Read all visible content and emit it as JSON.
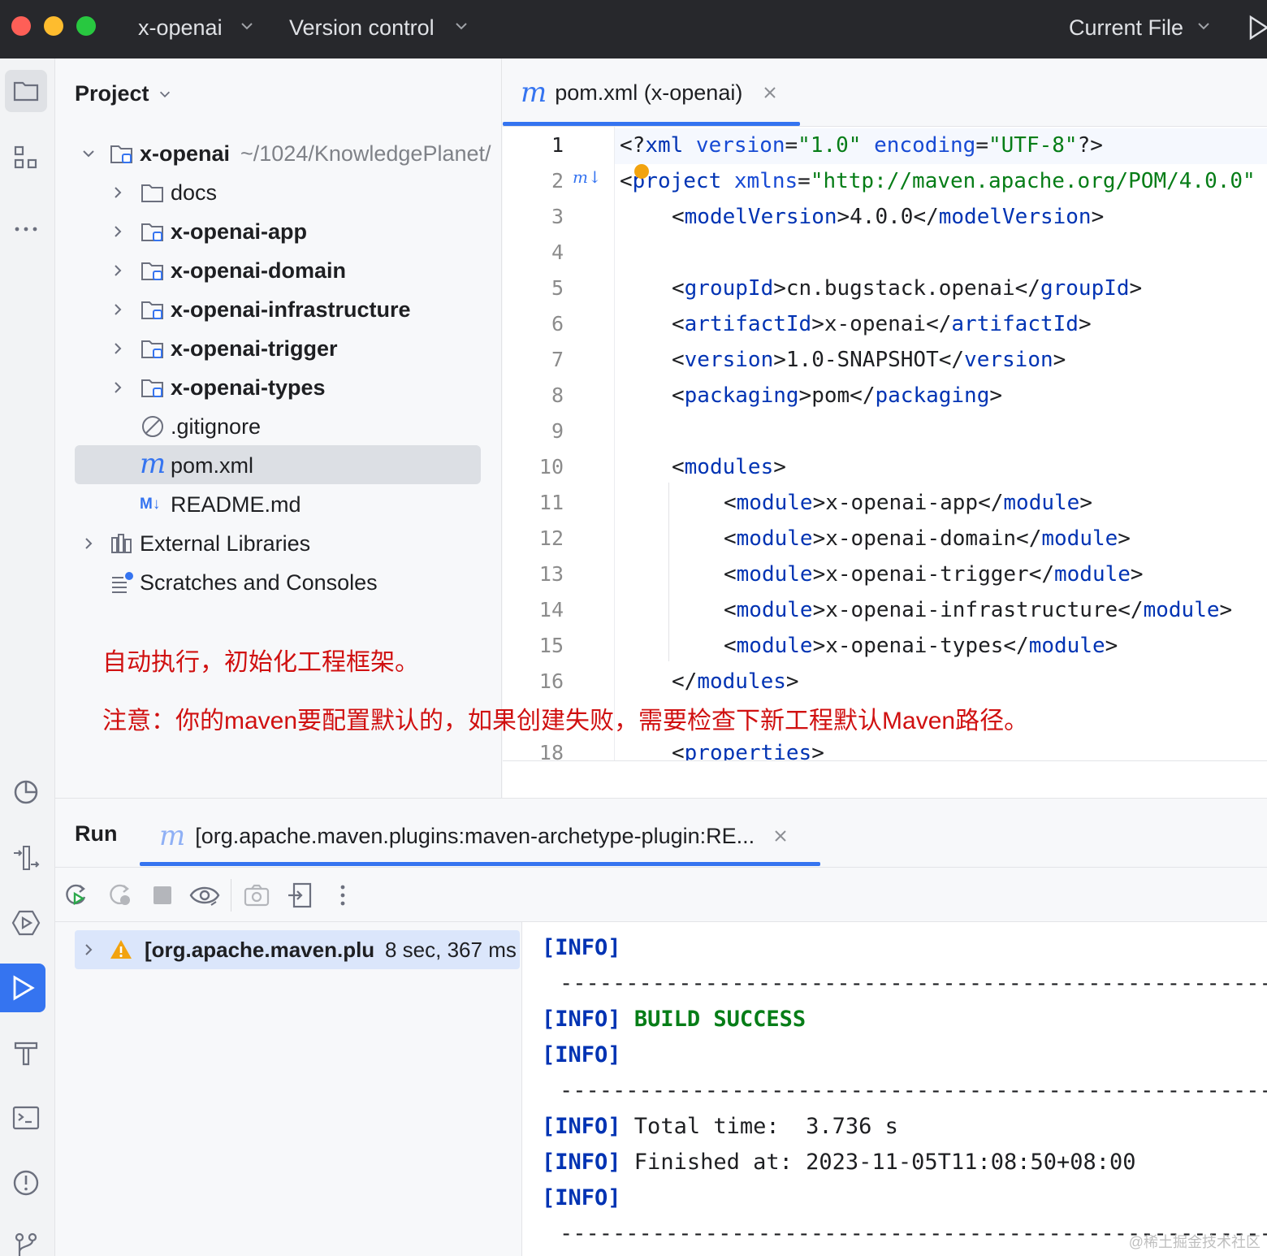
{
  "titlebar": {
    "project": "x-openai",
    "vcs": "Version control",
    "run_config": "Current File"
  },
  "project_panel": {
    "header": "Project",
    "root": {
      "name": "x-openai",
      "path": "~/1024/KnowledgePlanet/"
    },
    "items": [
      {
        "label": "docs",
        "type": "folder"
      },
      {
        "label": "x-openai-app",
        "type": "module"
      },
      {
        "label": "x-openai-domain",
        "type": "module"
      },
      {
        "label": "x-openai-infrastructure",
        "type": "module"
      },
      {
        "label": "x-openai-trigger",
        "type": "module"
      },
      {
        "label": "x-openai-types",
        "type": "module"
      },
      {
        "label": ".gitignore",
        "type": "ignore-file"
      },
      {
        "label": "pom.xml",
        "type": "maven-file"
      },
      {
        "label": "README.md",
        "type": "markdown-file"
      }
    ],
    "external_libraries": "External Libraries",
    "scratches": "Scratches and Consoles"
  },
  "notes": {
    "line1": "自动执行，初始化工程框架。",
    "line2": "注意：你的maven要配置默认的，如果创建失败，需要检查下新工程默认Maven路径。"
  },
  "editor": {
    "tab_label": "pom.xml (x-openai)",
    "line_numbers": [
      "1",
      "2",
      "3",
      "4",
      "5",
      "6",
      "7",
      "8",
      "9",
      "10",
      "11",
      "12",
      "13",
      "14",
      "15",
      "16",
      "18"
    ],
    "lines": {
      "l1": {
        "open": "<?",
        "tag": "xml",
        "a1": " version",
        "eq1": "=",
        "v1": "\"1.0\"",
        "a2": " encoding",
        "eq2": "=",
        "v2": "\"UTF-8\"",
        "close": "?>"
      },
      "l2": {
        "lt": "<",
        "tag": "project",
        "attr": " xmlns",
        "eq": "=",
        "val": "\"http://maven.apache.org/POM/4.0.0\""
      },
      "l3": {
        "open_tag": "modelVersion",
        "text": "4.0.0"
      },
      "l5": {
        "open_tag": "groupId",
        "text": "cn.bugstack.openai"
      },
      "l6": {
        "open_tag": "artifactId",
        "text": "x-openai"
      },
      "l7": {
        "open_tag": "version",
        "text": "1.0-SNAPSHOT"
      },
      "l8": {
        "open_tag": "packaging",
        "text": "pom"
      },
      "l10": {
        "tag": "modules"
      },
      "l11": {
        "tag": "module",
        "text": "x-openai-app"
      },
      "l12": {
        "tag": "module",
        "text": "x-openai-domain"
      },
      "l13": {
        "tag": "module",
        "text": "x-openai-trigger"
      },
      "l14": {
        "tag": "module",
        "text": "x-openai-infrastructure"
      },
      "l15": {
        "tag": "module",
        "text": "x-openai-types"
      },
      "l16": {
        "tag": "modules"
      },
      "l18": {
        "tag": "properties"
      }
    }
  },
  "run_panel": {
    "title": "Run",
    "tab_label": "[org.apache.maven.plugins:maven-archetype-plugin:RE...",
    "tree_item": {
      "label": "[org.apache.maven.plu",
      "duration": "8 sec, 367 ms"
    },
    "console": {
      "info": "[INFO]",
      "dashes": "------------------------------------------------------------------------",
      "build_success": "BUILD SUCCESS",
      "total_time": " Total time:  3.736 s",
      "finished_at": " Finished at: 2023-11-05T11:08:50+08:00"
    }
  },
  "watermark": "@稀土掘金技术社区",
  "colors": {
    "accent": "#3574f0",
    "tag": "#0033b3",
    "string": "#067d17",
    "note_red": "#d01010",
    "warning": "#f2a30f"
  }
}
